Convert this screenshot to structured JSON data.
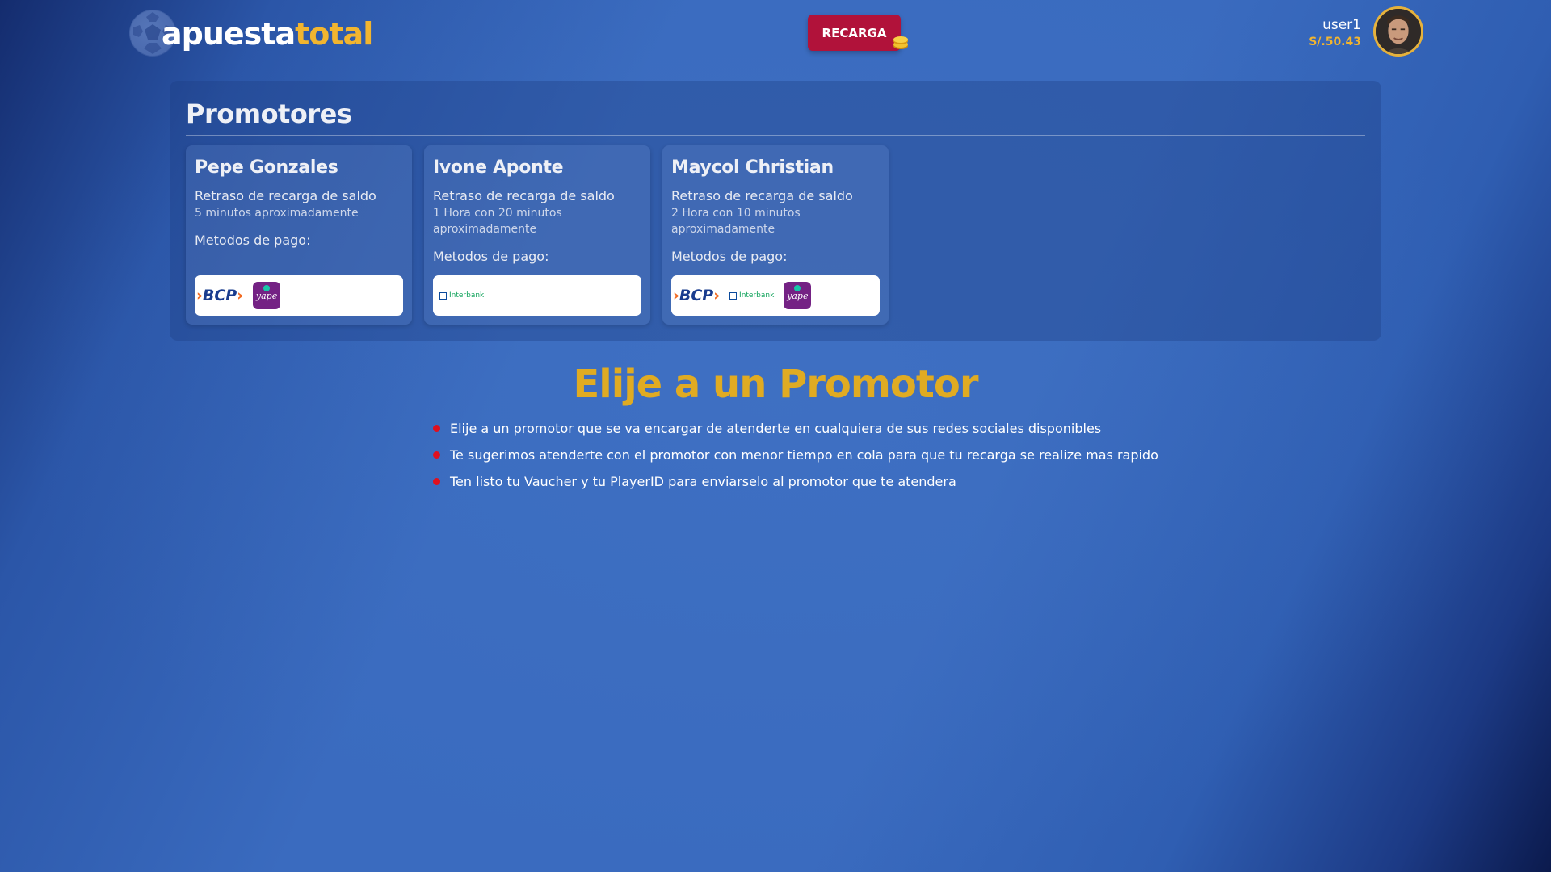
{
  "header": {
    "logo": {
      "part1": "apuesta",
      "part2": "total"
    },
    "recarga_label": "RECARGA",
    "user": {
      "name": "user1",
      "balance": "S/.50.43"
    }
  },
  "promotores": {
    "title": "Promotores",
    "cards": [
      {
        "name": "Pepe Gonzales",
        "delay_label": "Retraso de recarga de saldo",
        "delay": "5 minutos aproximadamente",
        "methods_label": "Metodos de pago:",
        "methods": [
          "bcp-logo",
          "yape-logo"
        ]
      },
      {
        "name": "Ivone Aponte",
        "delay_label": "Retraso de recarga de saldo",
        "delay": "1 Hora con 20 minutos aproximadamente",
        "methods_label": "Metodos de pago:",
        "methods": [
          "interbank-logo"
        ]
      },
      {
        "name": "Maycol Christian",
        "delay_label": "Retraso de recarga de saldo",
        "delay": "2 Hora con 10 minutos aproximadamente",
        "methods_label": "Metodos de pago:",
        "methods": [
          "bcp-logo",
          "interbank-logo",
          "yape-logo"
        ]
      }
    ]
  },
  "logos": {
    "bcp": "BCP",
    "interbank": "Interbank",
    "yape": "yape"
  },
  "elije": {
    "title": "Elije a un Promotor",
    "tips": [
      "Elije a un promotor que se va encargar de atenderte en cualquiera de sus redes sociales disponibles",
      "Te sugerimos atenderte con el promotor con menor tiempo en cola para que tu recarga se realize mas rapido",
      "Ten listo tu Vaucher y tu PlayerID para enviarselo al promotor que te atendera"
    ]
  },
  "colors": {
    "accent_gold": "#f2b52f",
    "recarga_red": "#b1123a",
    "bullet_red": "#e0101e",
    "bg_blue": "#3a6bbf"
  }
}
